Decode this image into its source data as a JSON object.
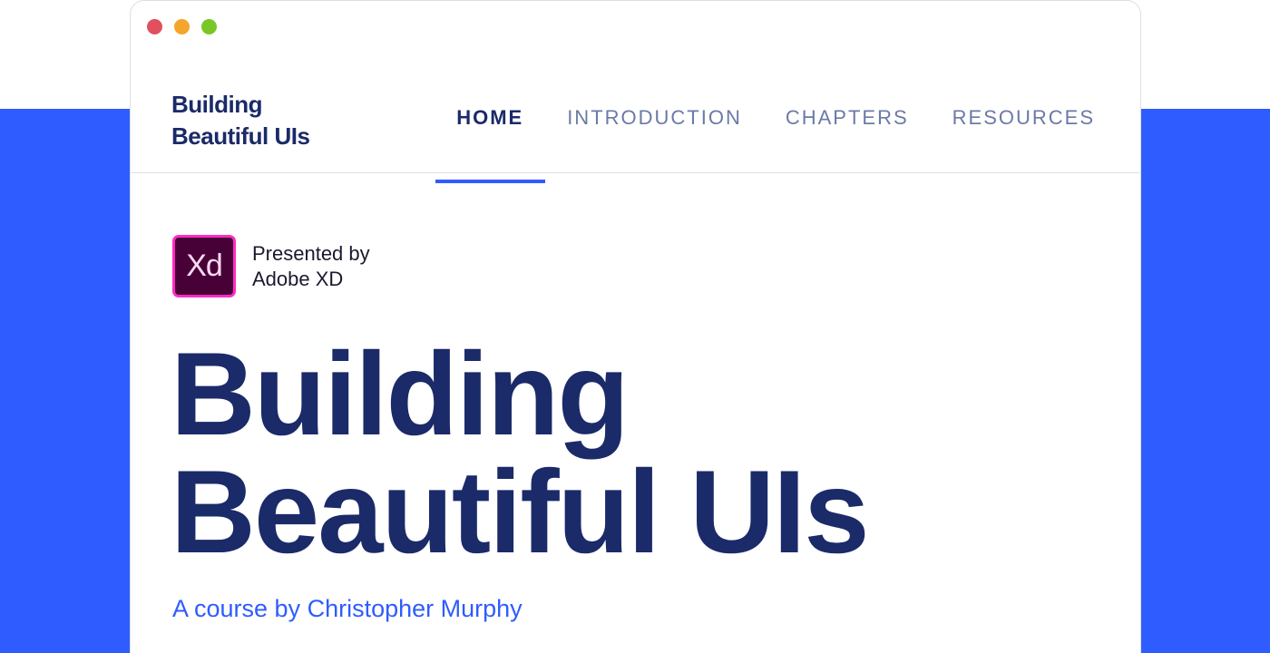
{
  "brand": {
    "line1": "Building",
    "line2": "Beautiful UIs"
  },
  "nav": {
    "items": [
      {
        "label": "HOME",
        "active": true
      },
      {
        "label": "INTRODUCTION",
        "active": false
      },
      {
        "label": "CHAPTERS",
        "active": false
      },
      {
        "label": "RESOURCES",
        "active": false
      }
    ]
  },
  "sponsor": {
    "logo_text": "Xd",
    "line1": "Presented by",
    "line2": "Adobe XD"
  },
  "hero": {
    "title_line1": "Building",
    "title_line2": "Beautiful UIs",
    "subtitle": "A course by Christopher Murphy"
  },
  "colors": {
    "accent": "#2f5cfe",
    "navy": "#1b2a68",
    "nav_inactive": "#6b7aa6",
    "xd_bg": "#470137",
    "xd_border": "#ff2bc2"
  },
  "icons": {
    "window_controls": [
      "close-dot",
      "minimize-dot",
      "maximize-dot"
    ]
  }
}
